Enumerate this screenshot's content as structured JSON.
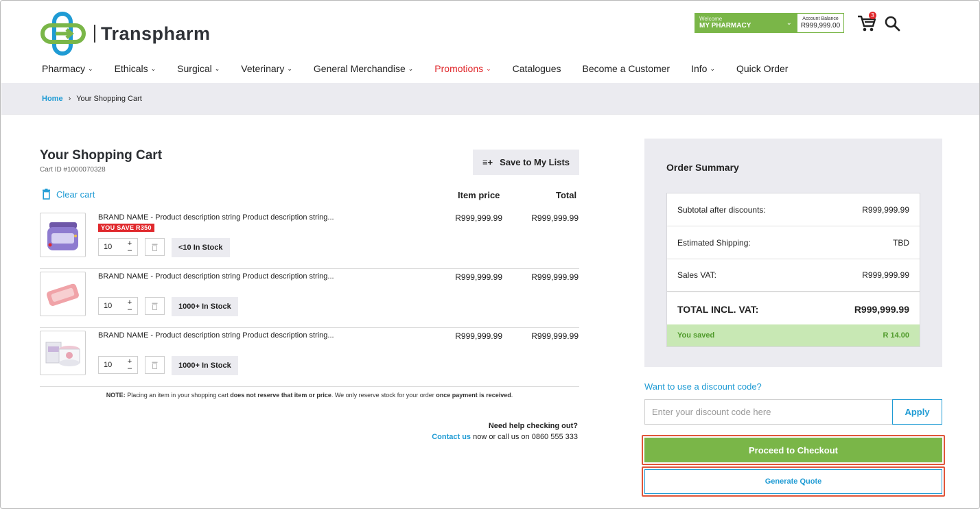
{
  "brand": {
    "name": "Transpharm",
    "accent": "#7ab648",
    "link": "#1f9bd4",
    "alert": "#e0282c"
  },
  "account": {
    "welcome_label": "Welcome",
    "name": "MY PHARMACY",
    "balance_label": "Account Balance",
    "balance_value": "R999,999.00",
    "cart_count": "3"
  },
  "nav": [
    {
      "label": "Pharmacy",
      "has_menu": true
    },
    {
      "label": "Ethicals",
      "has_menu": true
    },
    {
      "label": "Surgical",
      "has_menu": true
    },
    {
      "label": "Veterinary",
      "has_menu": true
    },
    {
      "label": "General Merchandise",
      "has_menu": true
    },
    {
      "label": "Promotions",
      "has_menu": true
    },
    {
      "label": "Catalogues",
      "has_menu": false
    },
    {
      "label": "Become a Customer",
      "has_menu": false
    },
    {
      "label": "Info",
      "has_menu": true
    },
    {
      "label": "Quick Order",
      "has_menu": false
    }
  ],
  "breadcrumb": {
    "home": "Home",
    "current": "Your Shopping Cart"
  },
  "cart": {
    "title": "Your Shopping Cart",
    "cart_id": "Cart ID #1000070328",
    "save_to_lists": "Save to My Lists",
    "clear_cart": "Clear cart",
    "col_item_price": "Item price",
    "col_total": "Total",
    "items": [
      {
        "description": "BRAND NAME - Product description string Product description string...",
        "badge": "YOU SAVE R350",
        "qty": "10",
        "stock": "<10 In Stock",
        "item_price": "R999,999.99",
        "total": "R999,999.99",
        "thumb": "jar-icon"
      },
      {
        "description": "BRAND NAME - Product description string Product description string...",
        "badge": "",
        "qty": "10",
        "stock": "1000+ In Stock",
        "item_price": "R999,999.99",
        "total": "R999,999.99",
        "thumb": "soap-icon"
      },
      {
        "description": "BRAND NAME - Product description string Product description string...",
        "badge": "",
        "qty": "10",
        "stock": "1000+ In Stock",
        "item_price": "R999,999.99",
        "total": "R999,999.99",
        "thumb": "box-icon"
      }
    ],
    "note": {
      "prefix": "NOTE:",
      "t1": " Placing an item in your shopping cart ",
      "b1": "does not reserve that item or price",
      "t2": ". We only reserve stock for your order ",
      "b2": "once payment is received",
      "t3": "."
    },
    "help": {
      "title": "Need help checking out?",
      "link": "Contact us",
      "rest": " now or call us on 0860 555 333"
    }
  },
  "summary": {
    "title": "Order Summary",
    "rows": [
      {
        "label": "Subtotal after discounts:",
        "value": "R999,999.99"
      },
      {
        "label": "Estimated Shipping:",
        "value": "TBD"
      },
      {
        "label": "Sales VAT:",
        "value": "R999,999.99"
      }
    ],
    "total_label": "TOTAL INCL. VAT:",
    "total_value": "R999,999.99",
    "saved_label": "You saved",
    "saved_value": "R 14.00"
  },
  "discount": {
    "label": "Want to use a discount code?",
    "placeholder": "Enter your discount code here",
    "apply": "Apply"
  },
  "actions": {
    "checkout": "Proceed to Checkout",
    "quote": "Generate Quote"
  }
}
